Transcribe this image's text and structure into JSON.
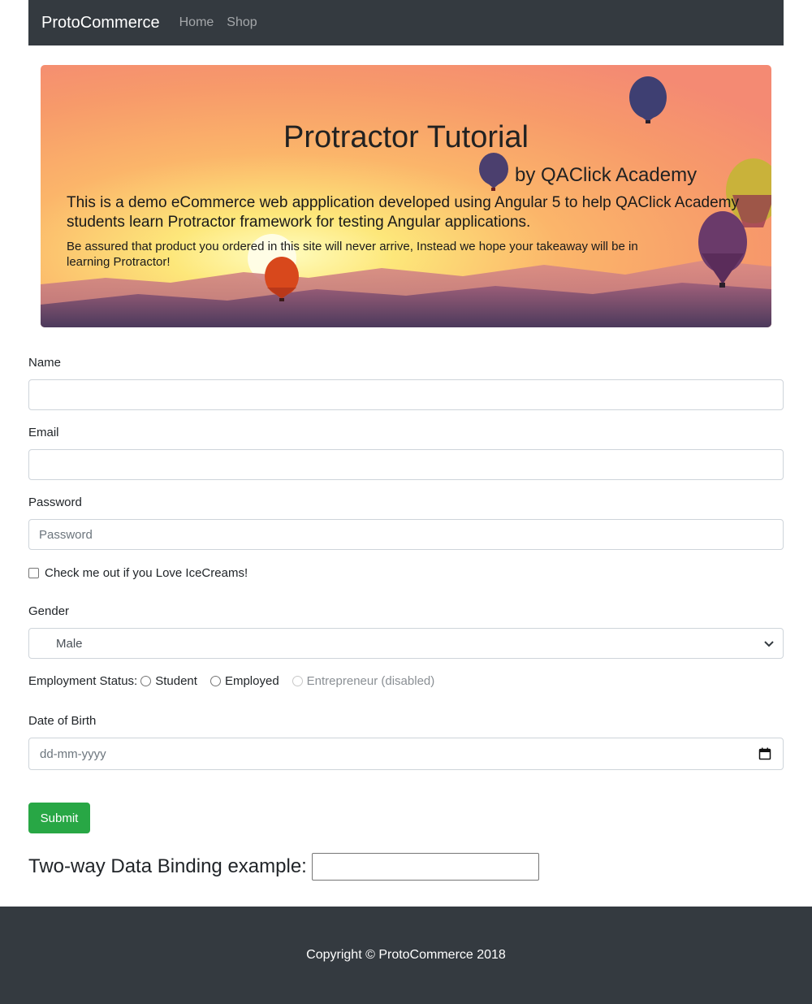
{
  "navbar": {
    "brand": "ProtoCommerce",
    "links": [
      "Home",
      "Shop"
    ]
  },
  "jumbotron": {
    "title": "Protractor Tutorial",
    "byline": "by QAClick Academy",
    "lead": "This is a demo eCommerce web appplication developed using Angular 5 to help QAClick Academy students learn Protractor framework for testing Angular applications.",
    "small": "Be assured that product you ordered in this site will never arrive, Instead we hope your takeaway will be in learning Protractor!"
  },
  "form": {
    "name_label": "Name",
    "name_value": "",
    "email_label": "Email",
    "email_value": "",
    "password_label": "Password",
    "password_placeholder": "Password",
    "checkbox_label": "Check me out if you Love IceCreams!",
    "gender_label": "Gender",
    "gender_selected": "Male",
    "employment_label": "Employment Status:",
    "employment_options": [
      "Student",
      "Employed",
      "Entrepreneur (disabled)"
    ],
    "dob_label": "Date of Birth",
    "dob_placeholder": "dd-mm-yyyy",
    "submit_label": "Submit",
    "binding_label": "Two-way Data Binding example:"
  },
  "footer": {
    "copyright": "Copyright © ProtoCommerce 2018"
  },
  "colors": {
    "navbar": "#343a40",
    "submit": "#28a745",
    "footer": "#343a40"
  },
  "icons": [
    "chevron-down-icon",
    "calendar-icon",
    "hot-air-balloon-icon"
  ]
}
